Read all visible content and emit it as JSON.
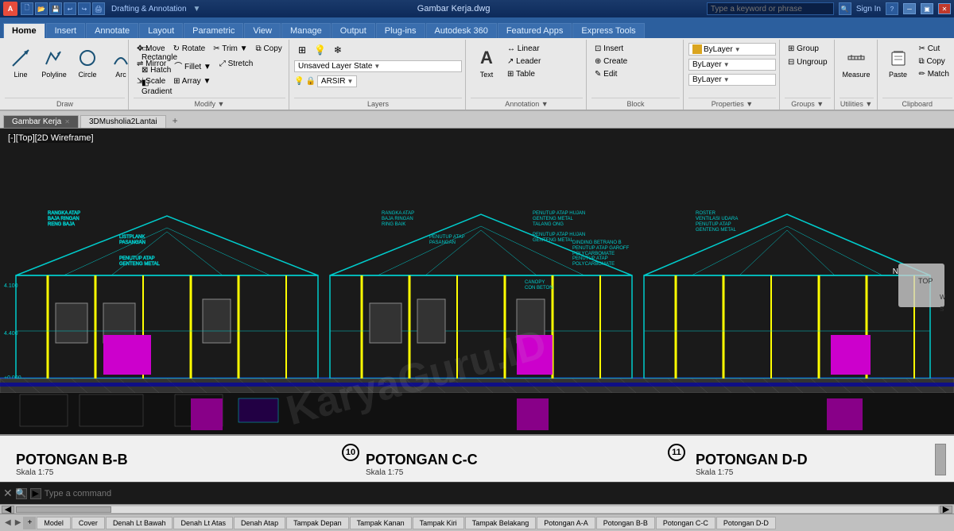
{
  "titlebar": {
    "logo": "A",
    "quick_access": [
      "new",
      "open",
      "save",
      "undo",
      "redo",
      "plot",
      "undo2"
    ],
    "workspace_label": "Drafting & Annotation",
    "filename": "Gambar Kerja.dwg",
    "search_placeholder": "Type a keyword or phrase",
    "sign_in": "Sign In",
    "window_buttons": [
      "minimize",
      "restore",
      "close"
    ]
  },
  "ribbon_tabs": [
    {
      "label": "Home",
      "active": true
    },
    {
      "label": "Insert"
    },
    {
      "label": "Annotate"
    },
    {
      "label": "Layout"
    },
    {
      "label": "Parametric"
    },
    {
      "label": "View"
    },
    {
      "label": "Manage"
    },
    {
      "label": "Output"
    },
    {
      "label": "Plug-ins"
    },
    {
      "label": "Autodesk 360"
    },
    {
      "label": "Featured Apps"
    },
    {
      "label": "Express Tools"
    }
  ],
  "ribbon_groups": {
    "draw": {
      "label": "Draw",
      "tools": [
        "Line",
        "Polyline",
        "Circle",
        "Arc"
      ]
    },
    "modify": {
      "label": "Modify",
      "tools": [
        "Move",
        "Rotate",
        "Trim",
        "Copy",
        "Mirror",
        "Fillet",
        "Stretch",
        "Scale",
        "Array"
      ]
    },
    "layers": {
      "label": "Layers",
      "layer_state": "Unsaved Layer State",
      "current_layer": "ARSIR"
    },
    "annotation": {
      "label": "Annotation",
      "tools": [
        "Text",
        "Linear",
        "Leader",
        "Table"
      ]
    },
    "block": {
      "label": "Block",
      "tools": [
        "Insert",
        "Create",
        "Edit"
      ]
    },
    "properties": {
      "label": "Properties",
      "options": [
        "ByLayer",
        "ByLayer",
        "ByLayer"
      ]
    },
    "groups": {
      "label": "Groups"
    },
    "utilities": {
      "label": "Utilities",
      "tools": [
        "Measure"
      ]
    },
    "clipboard": {
      "label": "Clipboard",
      "tools": [
        "Paste",
        "Copy"
      ]
    }
  },
  "doc_tabs": [
    {
      "label": "Gambar Kerja",
      "active": true
    },
    {
      "label": "3DMusholia2Lantai"
    }
  ],
  "viewport": {
    "view_label": "[-][Top][2D Wireframe]",
    "watermark": "KaryaGuru.ID"
  },
  "section_labels": [
    {
      "title": "POTONGAN B-B",
      "subtitle": "Skala 1:75",
      "circle_num": null,
      "left_pct": 6
    },
    {
      "title": "POTONGAN C-C",
      "subtitle": "Skala 1:75",
      "circle_num": "10",
      "left_pct": 40
    },
    {
      "title": "POTONGAN D-D",
      "subtitle": "Skala 1:75",
      "circle_num": "11",
      "left_pct": 74
    }
  ],
  "command_line": {
    "placeholder": "Type a command"
  },
  "sheet_tabs": [
    {
      "label": "Model",
      "active": false
    },
    {
      "label": "Cover"
    },
    {
      "label": "Denah Lt Bawah"
    },
    {
      "label": "Denah Lt Atas"
    },
    {
      "label": "Denah Atap"
    },
    {
      "label": "Tampak Depan"
    },
    {
      "label": "Tampak Kanan"
    },
    {
      "label": "Tampak Kiri"
    },
    {
      "label": "Tampak Belakang"
    },
    {
      "label": "Potongan A-A"
    },
    {
      "label": "Potongan B-B"
    },
    {
      "label": "Potongan C-C"
    },
    {
      "label": "Potongan D-D"
    }
  ],
  "colors": {
    "accent_blue": "#1e5fa8",
    "ribbon_bg": "#e8e8e8",
    "drawing_bg": "#1a1a1a",
    "section_bg": "#f5f5f5",
    "cad_cyan": "#00ffff",
    "cad_yellow": "#ffff00",
    "cad_magenta": "#ff00ff",
    "cad_blue": "#0000ff",
    "cad_white": "#ffffff"
  }
}
